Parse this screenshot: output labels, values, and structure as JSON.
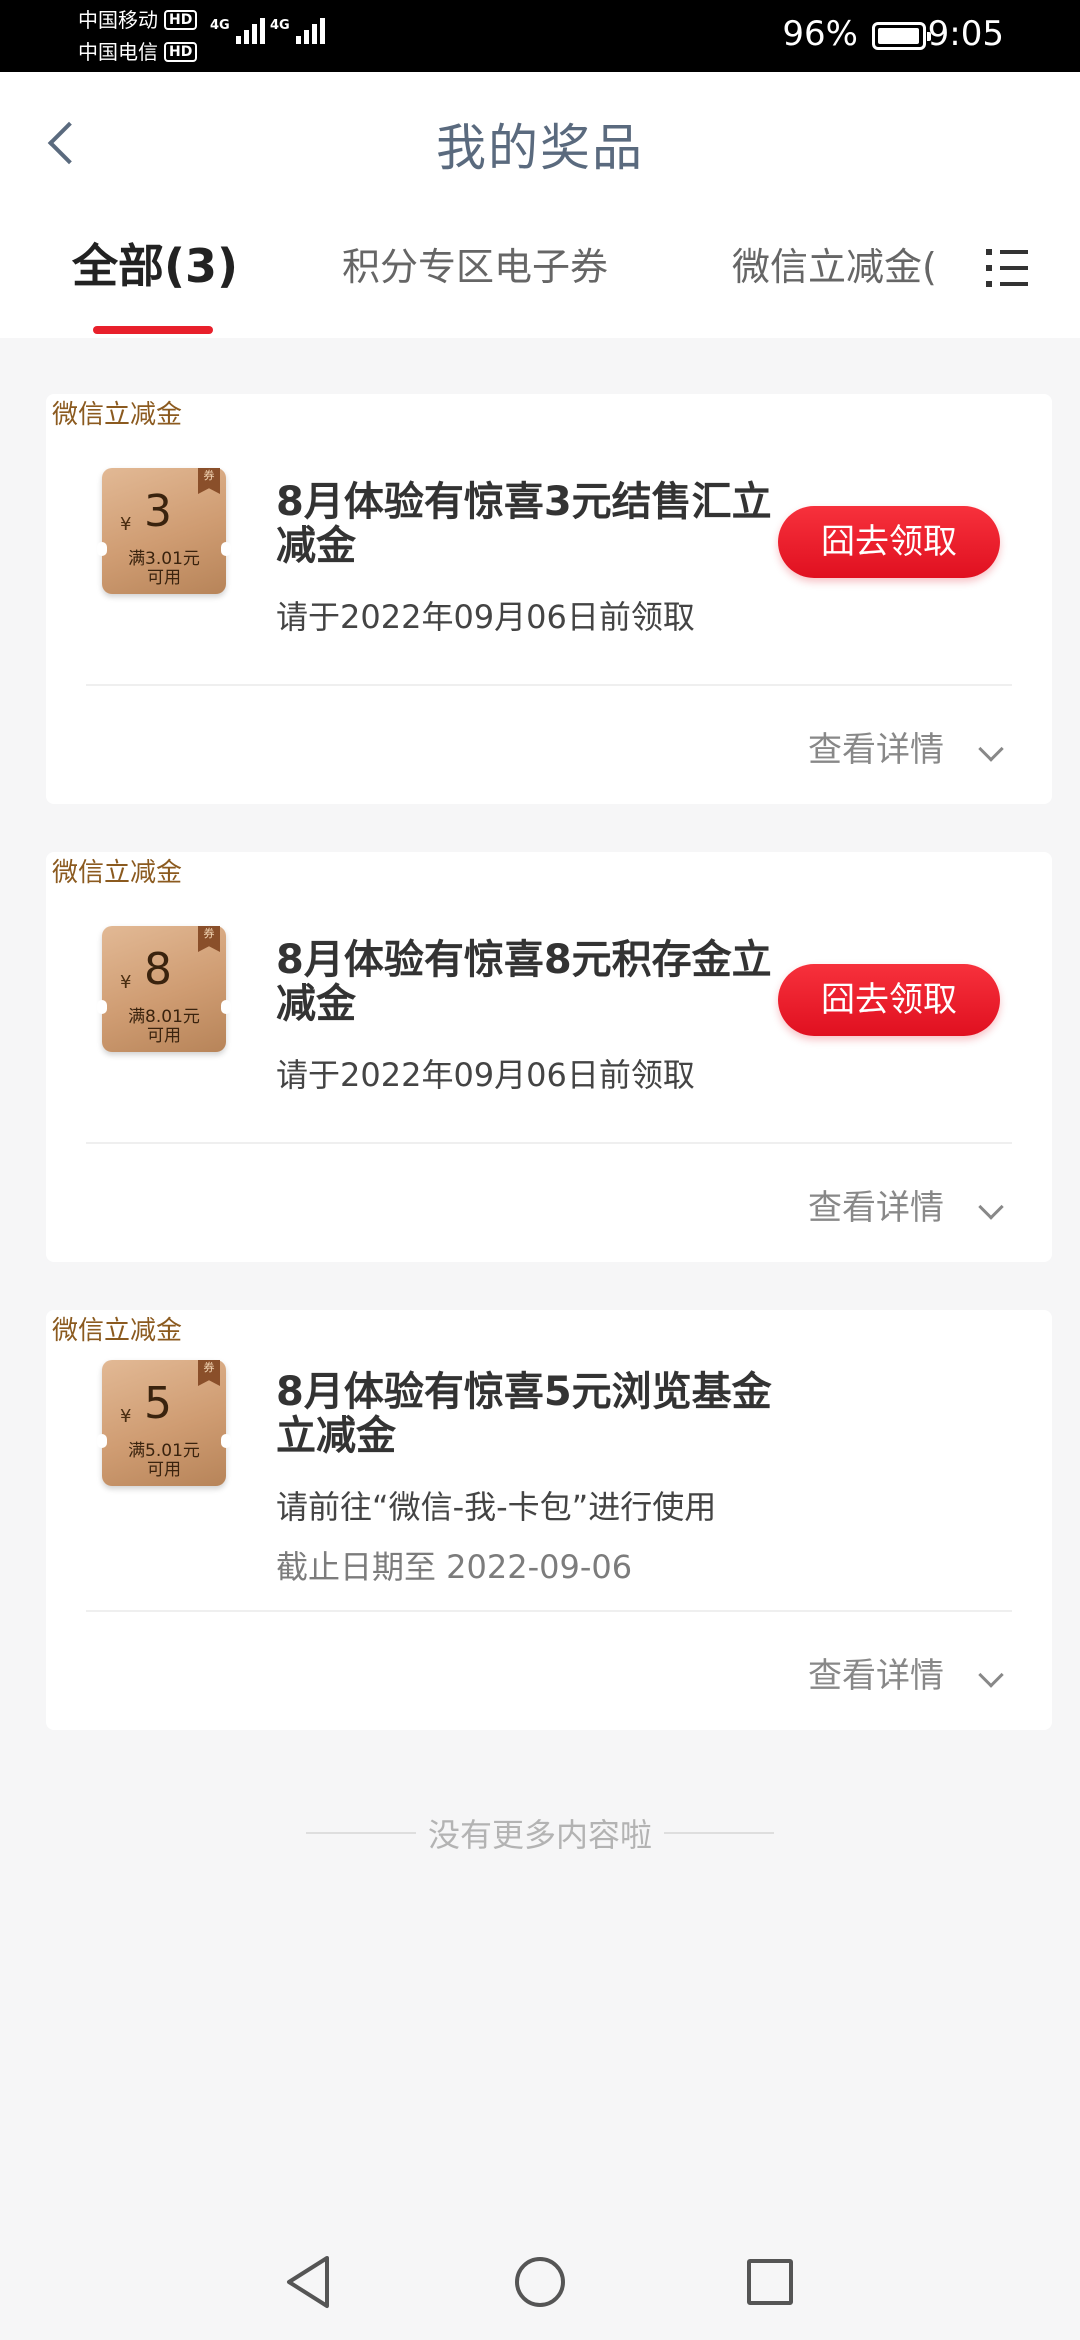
{
  "status_bar": {
    "carrier1": "中国移动",
    "carrier2": "中国电信",
    "hd_badge": "HD",
    "network1": "4G",
    "network2": "4G",
    "battery": "96%",
    "time": "9:05"
  },
  "header": {
    "title": "我的奖品",
    "tabs": [
      {
        "label": "全部(3)",
        "active": true
      },
      {
        "label": "积分专区电子券",
        "active": false
      },
      {
        "label": "微信立减金(",
        "active": false
      }
    ]
  },
  "cards": [
    {
      "tag": "微信立减金",
      "coupon": {
        "yen": "¥",
        "value": "3",
        "condition_line1": "满3.01元",
        "condition_line2": "可用",
        "ribbon": "券"
      },
      "title": "8月体验有惊喜3元结售汇立减金",
      "description": "请于2022年09月06日前领取",
      "button": "囧去领取",
      "details": "查看详情"
    },
    {
      "tag": "微信立减金",
      "coupon": {
        "yen": "¥",
        "value": "8",
        "condition_line1": "满8.01元",
        "condition_line2": "可用",
        "ribbon": "券"
      },
      "title": "8月体验有惊喜8元积存金立减金",
      "description": "请于2022年09月06日前领取",
      "button": "囧去领取",
      "details": "查看详情"
    },
    {
      "tag": "微信立减金",
      "coupon": {
        "yen": "¥",
        "value": "5",
        "condition_line1": "满5.01元",
        "condition_line2": "可用",
        "ribbon": "券"
      },
      "title": "8月体验有惊喜5元浏览基金立减金",
      "description": "请前往“微信-我-卡包”进行使用",
      "expiry": "截止日期至 2022-09-06",
      "details": "查看详情"
    }
  ],
  "footer_text": "没有更多内容啦",
  "colors": {
    "accent": "#e8202b",
    "title": "#5a6a7e",
    "tag": "#8b5a1f"
  }
}
